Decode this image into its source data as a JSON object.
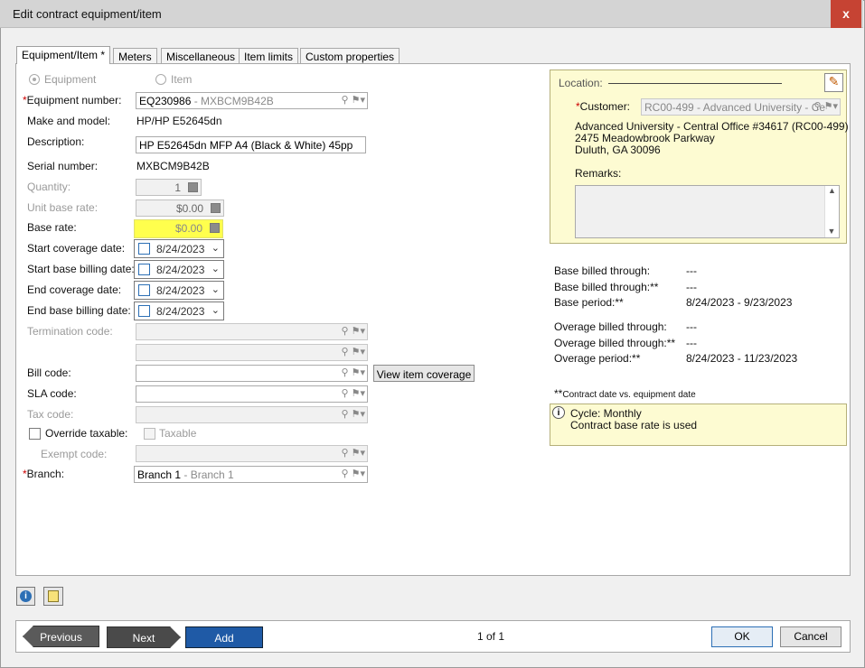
{
  "window": {
    "title": "Edit contract equipment/item",
    "close_label": "x"
  },
  "tabs": [
    {
      "label": "Equipment/Item *"
    },
    {
      "label": "Meters"
    },
    {
      "label": "Miscellaneous"
    },
    {
      "label": "Item limits"
    },
    {
      "label": "Custom properties"
    }
  ],
  "form": {
    "type_equipment": "Equipment",
    "type_item": "Item",
    "equipment_number_label": "Equipment number:",
    "equipment_number_value": "EQ230986",
    "equipment_number_sub": " - MXBCM9B42B",
    "make_model_label": "Make and model:",
    "make_model_value": "HP/HP E52645dn",
    "description_label": "Description:",
    "description_value": "HP E52645dn MFP A4 (Black & White) 45pp",
    "serial_label": "Serial number:",
    "serial_value": "MXBCM9B42B",
    "quantity_label": "Quantity:",
    "quantity_value": "1",
    "unit_base_rate_label": "Unit base rate:",
    "unit_base_rate_value": "$0.00",
    "base_rate_label": "Base rate:",
    "base_rate_value": "$0.00",
    "start_coverage_label": "Start coverage date:",
    "start_coverage_value": "8/24/2023",
    "start_billing_label": "Start base billing date:",
    "start_billing_value": "8/24/2023",
    "end_coverage_label": "End coverage date:",
    "end_coverage_value": "8/24/2023",
    "end_billing_label": "End base billing date:",
    "end_billing_value": "8/24/2023",
    "termination_label": "Termination code:",
    "bill_code_label": "Bill code:",
    "view_coverage_button": "View item coverage",
    "sla_label": "SLA code:",
    "tax_code_label": "Tax code:",
    "override_taxable_label": "Override taxable:",
    "taxable_label": "Taxable",
    "exempt_label": "Exempt code:",
    "branch_label": "Branch:",
    "branch_value": "Branch 1",
    "branch_sub": " - Branch 1"
  },
  "location": {
    "heading": "Location:",
    "customer_label": "Customer:",
    "customer_value": "RC00-499 - Advanced University - Ce",
    "address_line1": "Advanced University - Central Office #34617 (RC00-499)",
    "address_line2": "2475 Meadowbrook Parkway",
    "address_line3": "Duluth, GA 30096",
    "remarks_label": "Remarks:"
  },
  "billing": {
    "base_billed_through_label": "Base billed through:",
    "base_billed_through_value": "---",
    "base_billed_through2_label": "Base billed through:**",
    "base_billed_through2_value": "---",
    "base_period_label": "Base period:**",
    "base_period_value": "8/24/2023 - 9/23/2023",
    "overage_billed_through_label": "Overage billed through:",
    "overage_billed_through_value": "---",
    "overage_billed_through2_label": "Overage billed through:**",
    "overage_billed_through2_value": "---",
    "overage_period_label": "Overage period:**",
    "overage_period_value": "8/24/2023 - 11/23/2023",
    "footnote_marker": "**",
    "footnote_text": "Contract date vs. equipment date"
  },
  "info": {
    "cycle": "Cycle: Monthly",
    "rate_note": "Contract base rate is used"
  },
  "footer": {
    "previous": "Previous",
    "next": "Next",
    "add": "Add",
    "page_indicator": "1 of 1",
    "ok": "OK",
    "cancel": "Cancel"
  },
  "colors": {
    "highlight": "#ffff4d",
    "note_background": "#fdfbd2",
    "title_close": "#c64333",
    "add_button": "#1f5aa6",
    "nav_button": "#5a5a5a"
  }
}
